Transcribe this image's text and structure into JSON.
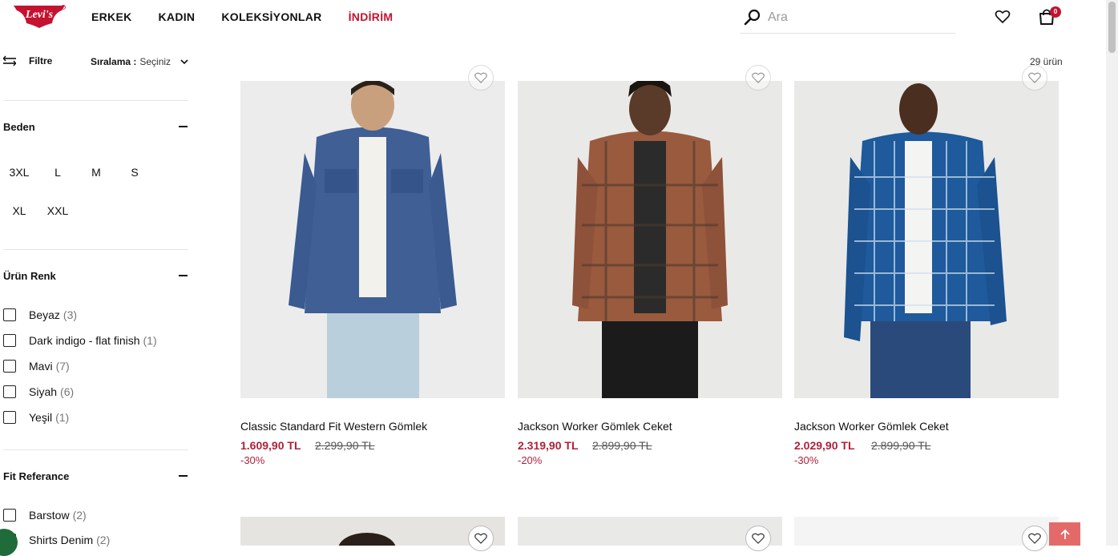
{
  "brand": {
    "logo_text": "Levi's",
    "accent": "#c41230"
  },
  "nav": {
    "items": [
      {
        "label": "ERKEK"
      },
      {
        "label": "KADIN"
      },
      {
        "label": "KOLEKSİYONLAR"
      },
      {
        "label": "İNDİRİM"
      }
    ]
  },
  "search": {
    "placeholder": "Ara",
    "value": ""
  },
  "cart": {
    "count": "0"
  },
  "toolbar": {
    "filter_label": "Filtre",
    "sort_label": "Sıralama :",
    "sort_value": "Seçiniz",
    "result_count": "29 ürün"
  },
  "filters": {
    "size": {
      "title": "Beden",
      "options": [
        "3XL",
        "L",
        "M",
        "S",
        "XL",
        "XXL"
      ]
    },
    "color": {
      "title": "Ürün Renk",
      "options": [
        {
          "label": "Beyaz",
          "count": "(3)"
        },
        {
          "label": "Dark indigo - flat finish",
          "count": "(1)"
        },
        {
          "label": "Mavi",
          "count": "(7)"
        },
        {
          "label": "Siyah",
          "count": "(6)"
        },
        {
          "label": "Yeşil",
          "count": "(1)"
        }
      ]
    },
    "fit": {
      "title": "Fit Referance",
      "options": [
        {
          "label": "Barstow",
          "count": "(2)"
        },
        {
          "label": "Shirts Denim",
          "count": "(2)"
        }
      ]
    }
  },
  "products": [
    {
      "name": "Classic Standard Fit Western Gömlek",
      "price": "1.609,90 TL",
      "old_price": "2.299,90 TL",
      "discount": "-30%"
    },
    {
      "name": "Jackson Worker Gömlek Ceket",
      "price": "2.319,90 TL",
      "old_price": "2.899,90 TL",
      "discount": "-20%"
    },
    {
      "name": "Jackson Worker Gömlek Ceket",
      "price": "2.029,90 TL",
      "old_price": "2.899,90 TL",
      "discount": "-30%"
    }
  ]
}
